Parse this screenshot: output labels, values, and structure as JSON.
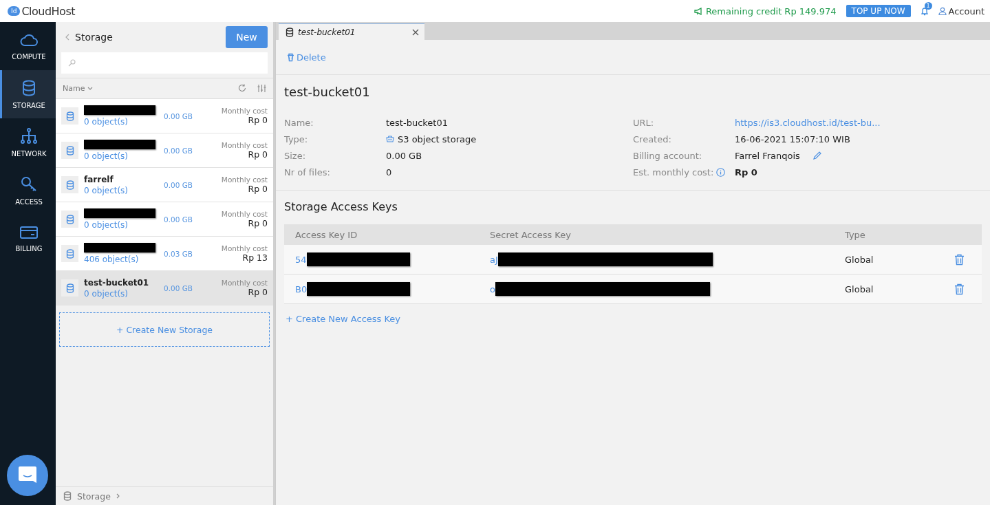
{
  "brand": {
    "badge": "Id",
    "name": "CloudHost"
  },
  "topbar": {
    "credit": "Remaining credit Rp 149.974",
    "topup": "TOP UP NOW",
    "notifications": "1",
    "account": "Account"
  },
  "nav": [
    {
      "label": "COMPUTE",
      "kind": "cloud",
      "selected": false
    },
    {
      "label": "STORAGE",
      "kind": "database",
      "selected": true
    },
    {
      "label": "NETWORK",
      "kind": "network",
      "selected": false
    },
    {
      "label": "ACCESS",
      "kind": "key",
      "selected": false
    },
    {
      "label": "BILLING",
      "kind": "card",
      "selected": false
    }
  ],
  "list": {
    "title": "Storage",
    "new_button": "New",
    "sort_column": "Name",
    "items": [
      {
        "redacted": true,
        "objects": "0 object(s)",
        "size": "0.00 GB",
        "cost_label": "Monthly cost",
        "cost": "Rp 0",
        "selected": false
      },
      {
        "redacted": true,
        "objects": "0 object(s)",
        "size": "0.00 GB",
        "cost_label": "Monthly cost",
        "cost": "Rp 0",
        "selected": false
      },
      {
        "redacted": false,
        "name": "farrelf",
        "objects": "0 object(s)",
        "size": "0.00 GB",
        "cost_label": "Monthly cost",
        "cost": "Rp 0",
        "selected": false
      },
      {
        "redacted": true,
        "objects": "0 object(s)",
        "size": "0.00 GB",
        "cost_label": "Monthly cost",
        "cost": "Rp 0",
        "selected": false
      },
      {
        "redacted": true,
        "objects": "406 object(s)",
        "size": "0.03 GB",
        "cost_label": "Monthly cost",
        "cost": "Rp 13",
        "selected": false
      },
      {
        "redacted": false,
        "name": "test-bucket01",
        "objects": "0 object(s)",
        "size": "0.00 GB",
        "cost_label": "Monthly cost",
        "cost": "Rp 0",
        "selected": true
      }
    ],
    "create_button": "+ Create New Storage",
    "breadcrumb": "Storage"
  },
  "detail": {
    "tab": {
      "label": "test-bucket01",
      "selected": true
    },
    "delete": "Delete",
    "title": "test-bucket01",
    "fields_left": [
      {
        "label": "Name:",
        "value": "test-bucket01",
        "kind": "text"
      },
      {
        "label": "Type:",
        "value": "S3 object storage",
        "kind": "type"
      },
      {
        "label": "Size:",
        "value": "0.00 GB",
        "kind": "text"
      },
      {
        "label": "Nr of files:",
        "value": "0",
        "kind": "text"
      }
    ],
    "fields_right": [
      {
        "label": "URL:",
        "value": "https://is3.cloudhost.id/test-bu...",
        "kind": "link"
      },
      {
        "label": "Created:",
        "value": "16-06-2021 15:07:10 WIB",
        "kind": "text"
      },
      {
        "label": "Billing account:",
        "value": "Farrel Franqois",
        "kind": "editable"
      },
      {
        "label": "Est. monthly cost:",
        "value": "Rp 0",
        "kind": "info"
      }
    ],
    "keys": {
      "title": "Storage Access Keys",
      "columns": [
        "Access Key ID",
        "Secret Access Key",
        "Type"
      ],
      "rows": [
        {
          "access_key_id": "54",
          "secret": "aJ",
          "redacted": true,
          "type": "Global"
        },
        {
          "access_key_id": "B0",
          "secret": "o",
          "redacted": true,
          "type": "Global"
        }
      ],
      "create": "+ Create New Access Key"
    }
  }
}
